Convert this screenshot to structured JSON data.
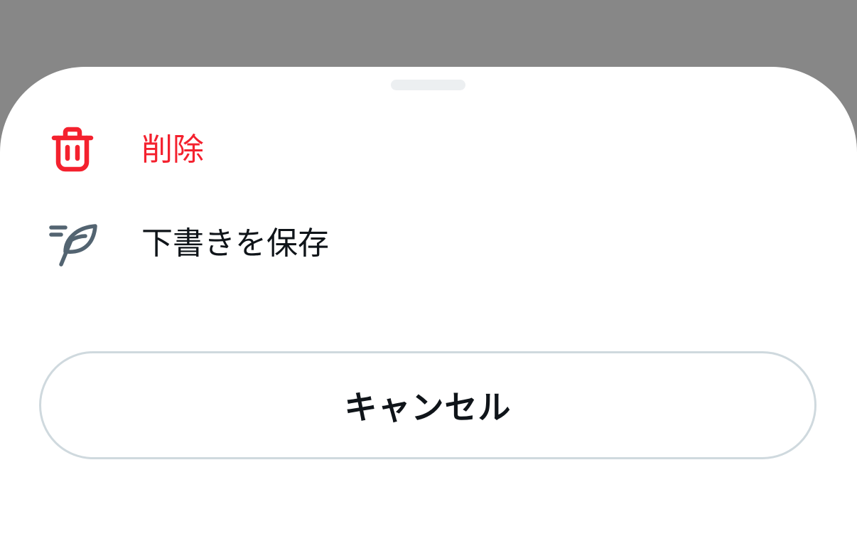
{
  "action_sheet": {
    "items": [
      {
        "label": "削除",
        "icon": "trash-icon",
        "color": "#f4212e"
      },
      {
        "label": "下書きを保存",
        "icon": "draft-feather-icon",
        "color": "#0f1419"
      }
    ],
    "cancel_label": "キャンセル"
  },
  "colors": {
    "backdrop": "#878787",
    "sheet": "#ffffff",
    "destructive": "#f4212e",
    "text_primary": "#0f1419",
    "icon_secondary": "#536471",
    "border": "#cfd9de",
    "grabber": "#eceff1"
  }
}
